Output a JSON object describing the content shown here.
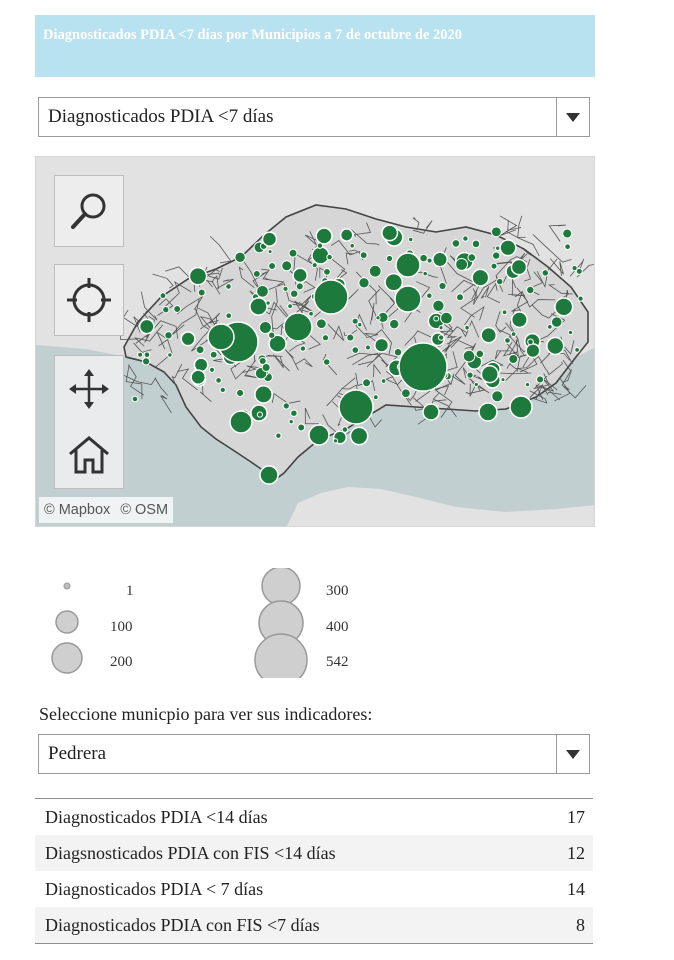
{
  "title": "Diagnosticados PDIA <7 días por Municipios a 7 de octubre de 2020",
  "indicator_select": {
    "selected": "Diagnosticados PDIA <7 días"
  },
  "map": {
    "tools": [
      "search-icon",
      "locate-icon",
      "pan-icon",
      "home-icon"
    ],
    "attribution": [
      "© Mapbox",
      "© OSM"
    ],
    "colors": {
      "land": "#e2e2e2",
      "sea": "#c2cfd1",
      "borders": "#555555",
      "bubble": "#1e7a3c",
      "bubble_stroke": "#ffffff"
    }
  },
  "legend": {
    "items": [
      {
        "label": "1",
        "value": 1
      },
      {
        "label": "100",
        "value": 100
      },
      {
        "label": "200",
        "value": 200
      },
      {
        "label": "300",
        "value": 300
      },
      {
        "label": "400",
        "value": 400
      },
      {
        "label": "542",
        "value": 542
      }
    ]
  },
  "municipio_prompt": "Seleccione municpio para ver sus indicadores:",
  "municipio_select": {
    "selected": "Pedrera"
  },
  "indicators": [
    {
      "label": "Diagnosticados PDIA <14 días",
      "value": "17"
    },
    {
      "label": "Diagsnosticados PDIA con FIS <14 días",
      "value": "12"
    },
    {
      "label": "Diagnosticados PDIA < 7 días",
      "value": "14"
    },
    {
      "label": "Diagnosticados PDIA con FIS <7 días",
      "value": "8"
    }
  ]
}
